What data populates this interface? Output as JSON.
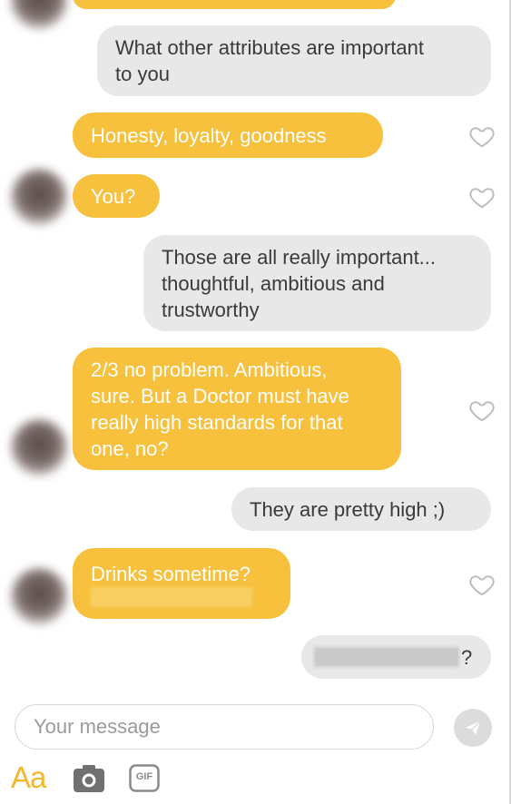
{
  "messages": [
    {
      "id": "m0",
      "side": "incoming",
      "text": ""
    },
    {
      "id": "m1",
      "side": "outgoing",
      "lines": [
        "What other attributes are important",
        "to you"
      ]
    },
    {
      "id": "m2",
      "side": "incoming",
      "text": "Honesty, loyalty, goodness"
    },
    {
      "id": "m3",
      "side": "incoming",
      "text": "You?"
    },
    {
      "id": "m4",
      "side": "outgoing",
      "lines": [
        "Those are all really important...",
        "thoughtful, ambitious and",
        "trustworthy"
      ]
    },
    {
      "id": "m5",
      "side": "incoming",
      "lines": [
        "2/3 no problem. Ambitious,",
        "sure. But a Doctor must have",
        "really high standards for that",
        "one, no?"
      ]
    },
    {
      "id": "m6",
      "side": "outgoing",
      "text": "They are pretty high ;)"
    },
    {
      "id": "m7",
      "side": "incoming",
      "text": "Drinks sometime?"
    },
    {
      "id": "m8",
      "side": "outgoing",
      "text_suffix": "?"
    }
  ],
  "composer": {
    "placeholder": "Your message",
    "text_format_label": "Aa"
  },
  "icons": {
    "like": "heart-outline-icon",
    "send": "send-icon",
    "camera": "camera-icon",
    "gif": "gif-icon"
  },
  "gif_label": "GIF",
  "colors": {
    "incoming_bubble": "#f7c13d",
    "outgoing_bubble": "#e8e8e8",
    "accent": "#f2b72c"
  }
}
